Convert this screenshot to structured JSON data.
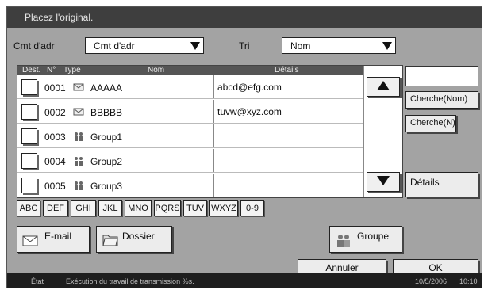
{
  "header": {
    "title": "Placez l'original."
  },
  "filters": {
    "addr_label": "Cmt d'adr",
    "addr_value": "Cmt d'adr",
    "sort_label": "Tri",
    "sort_value": "Nom"
  },
  "table": {
    "headers": {
      "dest": "Dest.",
      "num": "N°",
      "type": "Type",
      "name": "Nom",
      "details": "Détails"
    },
    "rows": [
      {
        "num": "0001",
        "type": "email-icon",
        "name": "AAAAA",
        "detail": "abcd@efg.com"
      },
      {
        "num": "0002",
        "type": "email-icon",
        "name": "BBBBB",
        "detail": "tuvw@xyz.com"
      },
      {
        "num": "0003",
        "type": "group-icon",
        "name": "Group1",
        "detail": ""
      },
      {
        "num": "0004",
        "type": "group-icon",
        "name": "Group2",
        "detail": ""
      },
      {
        "num": "0005",
        "type": "group-icon",
        "name": "Group3",
        "detail": ""
      }
    ]
  },
  "side": {
    "search_name": "Cherche(Nom)",
    "search_num": "Cherche(N)",
    "details": "Détails"
  },
  "alpha_tabs": [
    "ABC",
    "DEF",
    "GHI",
    "JKL",
    "MNO",
    "PQRS",
    "TUV",
    "WXYZ",
    "0-9"
  ],
  "actions": {
    "email": "E-mail",
    "folder": "Dossier",
    "group": "Groupe"
  },
  "bottom": {
    "cancel": "Annuler",
    "ok": "OK"
  },
  "status": {
    "state": "État",
    "message": "Exécution du travail de transmission %s.",
    "date": "10/5/2006",
    "time": "10:10"
  }
}
